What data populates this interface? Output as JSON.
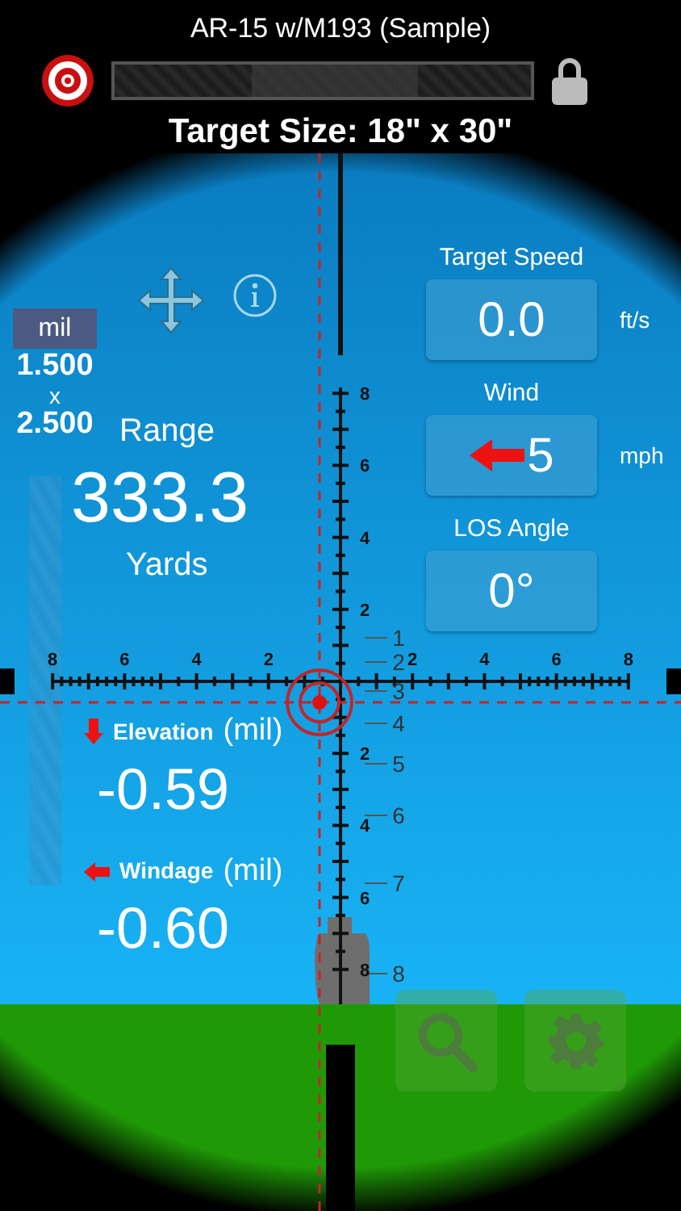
{
  "header": {
    "profile": "AR-15 w/M193 (Sample)",
    "target_size": "Target Size: 18\" x 30\""
  },
  "reticle": {
    "horizontal_labels": [
      "8",
      "6",
      "4",
      "2",
      "2",
      "4",
      "6",
      "8"
    ],
    "vertical_labels": [
      "8",
      "6",
      "4",
      "2",
      "2",
      "4",
      "6",
      "8"
    ],
    "range_scale": [
      "1",
      "2",
      "3",
      "4",
      "5",
      "6",
      "7",
      "8"
    ]
  },
  "units": {
    "unit": "mil",
    "first": "1.500",
    "separator": "x",
    "second": "2.500"
  },
  "range": {
    "label": "Range",
    "value": "333.3",
    "unit": "Yards"
  },
  "inputs": [
    {
      "label": "Target Speed",
      "value": "0.0",
      "unit": "ft/s",
      "arrow": false
    },
    {
      "label": "Wind",
      "value": "5",
      "unit": "mph",
      "arrow": true
    },
    {
      "label": "LOS Angle",
      "value": "0°",
      "arrow": false
    }
  ],
  "corrections": [
    {
      "kind": "elevation",
      "label": "Elevation",
      "unit": "(mil)",
      "value": "-0.59"
    },
    {
      "kind": "windage",
      "label": "Windage",
      "unit": "(mil)",
      "value": "-0.60"
    }
  ]
}
